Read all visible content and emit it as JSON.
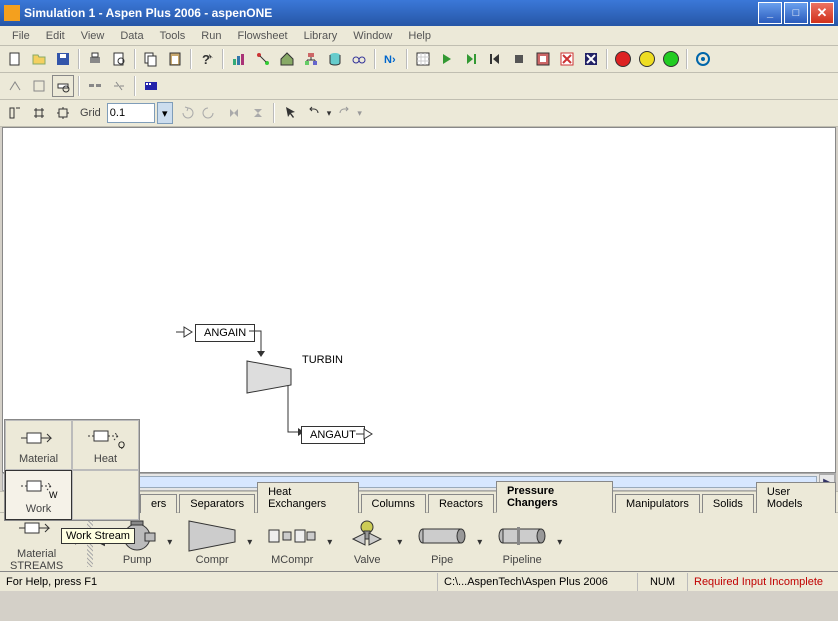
{
  "title": "Simulation 1 - Aspen Plus 2006 - aspenONE",
  "menu": [
    "File",
    "Edit",
    "View",
    "Data",
    "Tools",
    "Run",
    "Flowsheet",
    "Library",
    "Window",
    "Help"
  ],
  "toolbar3": {
    "gridLabel": "Grid",
    "gridValue": "0.1"
  },
  "flowsheet": {
    "streamIn": "ANGAIN",
    "unit": "TURBIN",
    "streamOut": "ANGAUT"
  },
  "palette": {
    "material": "Material",
    "heat": "Heat",
    "work": "Work",
    "tooltip": "Work Stream"
  },
  "categories": {
    "items": [
      "ers",
      "Separators",
      "Heat Exchangers",
      "Columns",
      "Reactors",
      "Pressure Changers",
      "Manipulators",
      "Solids",
      "User Models"
    ],
    "activeIndex": 5
  },
  "models": {
    "streams": "Material\nSTREAMS",
    "items": [
      "Pump",
      "Compr",
      "MCompr",
      "Valve",
      "Pipe",
      "Pipeline"
    ]
  },
  "status": {
    "help": "For Help, press F1",
    "path": "C:\\...AspenTech\\Aspen Plus 2006",
    "num": "NUM",
    "required": "Required Input Incomplete"
  }
}
